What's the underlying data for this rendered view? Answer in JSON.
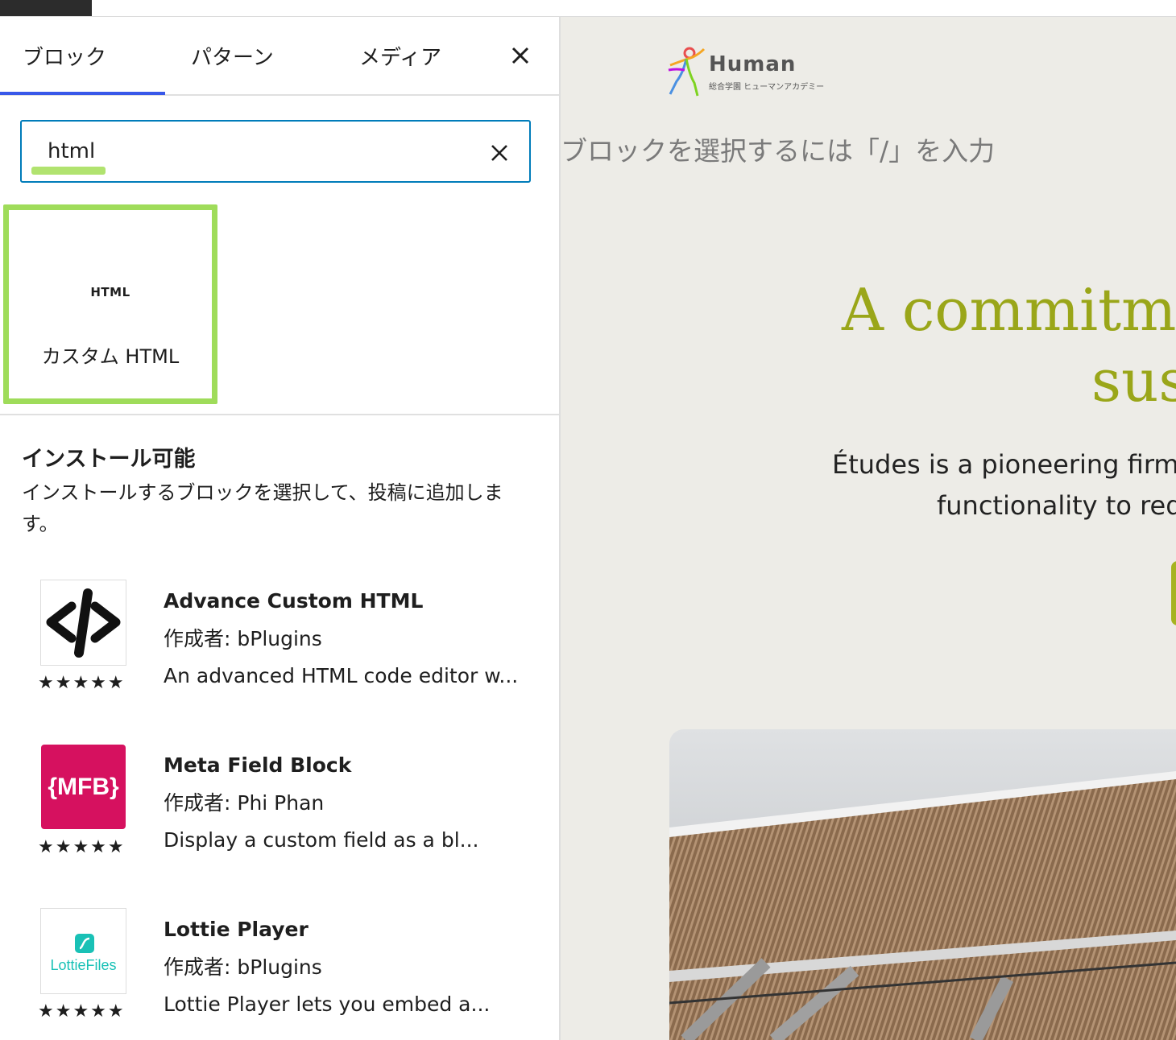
{
  "tabs": [
    {
      "label": "ブロック"
    },
    {
      "label": "パターン"
    },
    {
      "label": "メディア"
    }
  ],
  "search": {
    "value": "html"
  },
  "result_block": {
    "icon_text": "HTML",
    "label": "カスタム HTML"
  },
  "installable": {
    "title": "インストール可能",
    "description": "インストールするブロックを選択して、投稿に追加します。"
  },
  "plugins": [
    {
      "name": "Advance Custom HTML",
      "author": "作成者: bPlugins",
      "description": "An advanced HTML code editor w...",
      "stars": "★★★★★",
      "rating": 5
    },
    {
      "name": "Meta Field Block",
      "author": "作成者: Phi Phan",
      "description": "Display a custom field as a bl...",
      "icon_text": "{MFB}",
      "stars": "★★★★★",
      "rating": 5
    },
    {
      "name": "Lottie Player",
      "author": "作成者: bPlugins",
      "description": "Lottie Player lets you embed a...",
      "icon_text": "LottieFiles",
      "stars": "★★★★★",
      "rating": 5
    }
  ],
  "canvas": {
    "logo": {
      "word": "Human",
      "sub": "総合学園 ヒューマンアカデミー"
    },
    "placeholder": "ブロックを選択するには「/」を入力",
    "heading_line1": "A commitmen",
    "heading_line2": "sust",
    "paragraph_line1": "Études is a pioneering firm",
    "paragraph_line2": "functionality to red"
  },
  "colors": {
    "accent": "#007cba",
    "tab_indicator": "#3858e9",
    "highlight": "#9fdc5a",
    "heading": "#9aa619",
    "mfb": "#d6115f",
    "lottie": "#19c1b6"
  }
}
